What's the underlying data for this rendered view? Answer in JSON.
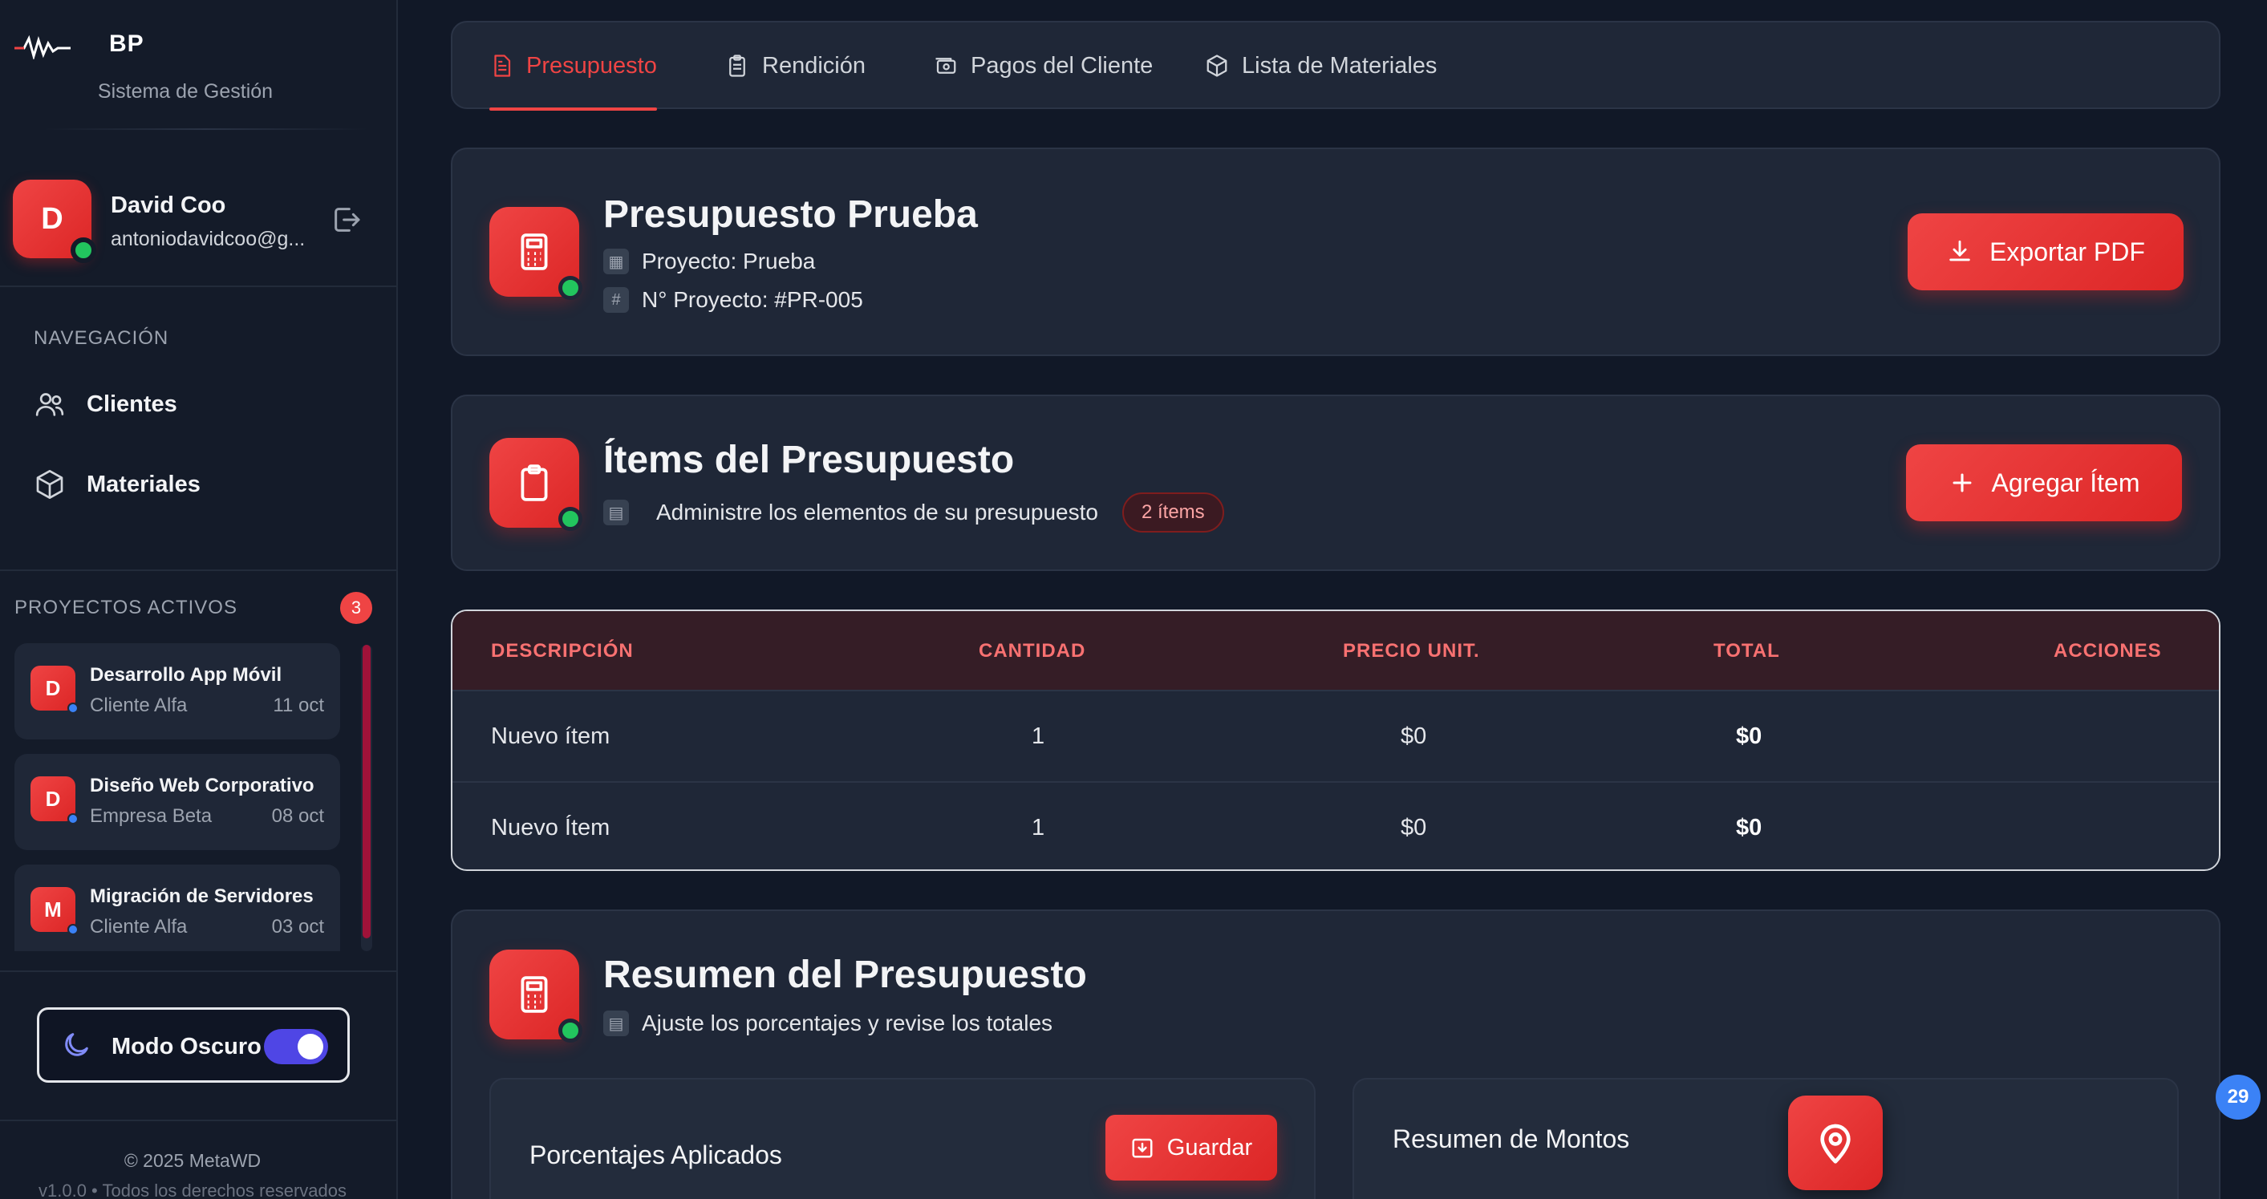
{
  "brand": {
    "logo_text": "BP",
    "subtitle": "Sistema de Gestión"
  },
  "user": {
    "initial": "D",
    "name": "David Coo",
    "email": "antoniodavidcoo@g..."
  },
  "nav": {
    "title": "NAVEGACIÓN",
    "items": [
      {
        "label": "Clientes",
        "icon": "users-icon"
      },
      {
        "label": "Materiales",
        "icon": "box-icon"
      }
    ]
  },
  "projects": {
    "title": "PROYECTOS ACTIVOS",
    "count": "3",
    "items": [
      {
        "initial": "D",
        "name": "Desarrollo App Móvil",
        "client": "Cliente Alfa",
        "date": "11 oct"
      },
      {
        "initial": "D",
        "name": "Diseño Web Corporativo",
        "client": "Empresa Beta",
        "date": "08 oct"
      },
      {
        "initial": "M",
        "name": "Migración de Servidores",
        "client": "Cliente Alfa",
        "date": "03 oct"
      }
    ]
  },
  "theme_toggle": {
    "label": "Modo Oscuro",
    "enabled": true
  },
  "footer": {
    "copyright": "© 2025 MetaWD",
    "version": "v1.0.0 • Todos los derechos reservados"
  },
  "tabs": [
    {
      "label": "Presupuesto",
      "active": true
    },
    {
      "label": "Rendición",
      "active": false
    },
    {
      "label": "Pagos del Cliente",
      "active": false
    },
    {
      "label": "Lista de Materiales",
      "active": false
    }
  ],
  "budget": {
    "title": "Presupuesto Prueba",
    "project": "Proyecto: Prueba",
    "project_number": "N° Proyecto: #PR-005",
    "export_label": "Exportar PDF"
  },
  "items_section": {
    "title": "Ítems del Presupuesto",
    "subtitle": "Administre los elementos de su presupuesto",
    "count_badge": "2 ítems",
    "add_label": "Agregar Ítem"
  },
  "table": {
    "headers": [
      "DESCRIPCIÓN",
      "CANTIDAD",
      "PRECIO UNIT.",
      "TOTAL",
      "ACCIONES"
    ],
    "rows": [
      [
        "Nuevo ítem",
        "1",
        "$0",
        "$0"
      ],
      [
        "Nuevo Ítem",
        "1",
        "$0",
        "$0"
      ]
    ]
  },
  "summary": {
    "title": "Resumen del Presupuesto",
    "subtitle": "Ajuste los porcentajes y revise los totales",
    "percentages_title": "Porcentajes Aplicados",
    "save_label": "Guardar",
    "amounts_title": "Resumen de Montos"
  },
  "fab": {
    "badge": "29"
  },
  "colors": {
    "accent": "#ef4444",
    "background": "#111827",
    "card": "#1f2737",
    "online": "#22c55e",
    "toggle": "#4f46e5"
  }
}
